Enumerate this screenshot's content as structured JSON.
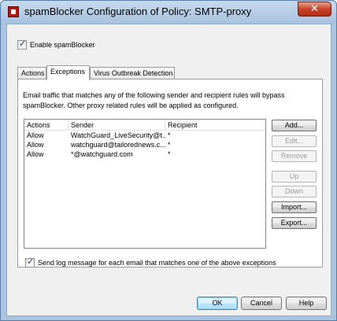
{
  "window": {
    "title": "spamBlocker Configuration of Policy: SMTP-proxy",
    "close_glyph": "✕"
  },
  "enable": {
    "label": "Enable spamBlocker",
    "checked": true
  },
  "tabs": [
    {
      "label": "Actions",
      "active": false
    },
    {
      "label": "Exceptions",
      "active": true
    },
    {
      "label": "Virus Outbreak Detection",
      "active": false
    }
  ],
  "exceptions": {
    "description": "Email traffic that matches any of the following sender and recipient rules will bypass spamBlocker. Other proxy related rules will be applied as configured.",
    "columns": [
      "Actions",
      "Sender",
      "Recipient"
    ],
    "rows": [
      {
        "action": "Allow",
        "sender": "WatchGuard_LiveSecurity@t...",
        "recipient": "*"
      },
      {
        "action": "Allow",
        "sender": "watchguard@tailorednews.c...",
        "recipient": "*"
      },
      {
        "action": "Allow",
        "sender": "*@watchguard.com",
        "recipient": "*"
      }
    ],
    "buttons": {
      "add": "Add...",
      "edit": "Edit...",
      "remove": "Remove",
      "up": "Up",
      "down": "Down",
      "import": "Import...",
      "export": "Export..."
    },
    "log_label": "Send log message for each email that matches one of the above exceptions",
    "log_checked": true
  },
  "footer": {
    "ok": "OK",
    "cancel": "Cancel",
    "help": "Help"
  },
  "colors": {
    "frame": "#aac4de",
    "client": "#f0f0f0",
    "close": "#c7432b"
  }
}
